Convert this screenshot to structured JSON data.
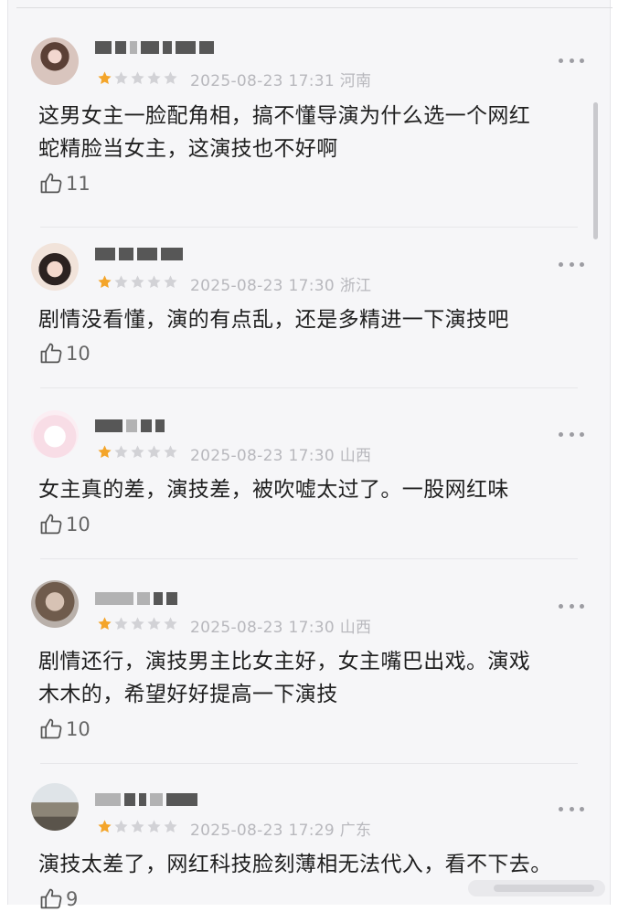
{
  "colors": {
    "star_filled": "#f4a52a",
    "star_empty": "#d2d2d6",
    "meta_text": "#b8b8bd",
    "body_text": "#1f1f1f",
    "like_icon": "#555555"
  },
  "icons": {
    "more": "more-horizontal-icon",
    "like": "thumbs-up-icon",
    "star": "star-icon"
  },
  "comments": [
    {
      "rating": 1,
      "meta": "2025-08-23 17:31 河南",
      "text_line1": "这男女主一脸配角相，搞不懂导演为什么选一个网红",
      "text_line2": "蛇精脸当女主，这演技也不好啊",
      "likes": "11"
    },
    {
      "rating": 1,
      "meta": "2025-08-23 17:30 浙江",
      "text_line1": "剧情没看懂，演的有点乱，还是多精进一下演技吧",
      "likes": "10"
    },
    {
      "rating": 1,
      "meta": "2025-08-23 17:30 山西",
      "text_line1": "女主真的差，演技差，被吹嘘太过了。一股网红味",
      "likes": "10"
    },
    {
      "rating": 1,
      "meta": "2025-08-23 17:30 山西",
      "text_line1": "剧情还行，演技男主比女主好，女主嘴巴出戏。演戏",
      "text_line2": "木木的，希望好好提高一下演技",
      "likes": "10"
    },
    {
      "rating": 1,
      "meta": "2025-08-23 17:29 广东",
      "text_line1": "演技太差了，网红科技脸刻薄相无法代入，看不下去。",
      "likes": "9"
    }
  ]
}
